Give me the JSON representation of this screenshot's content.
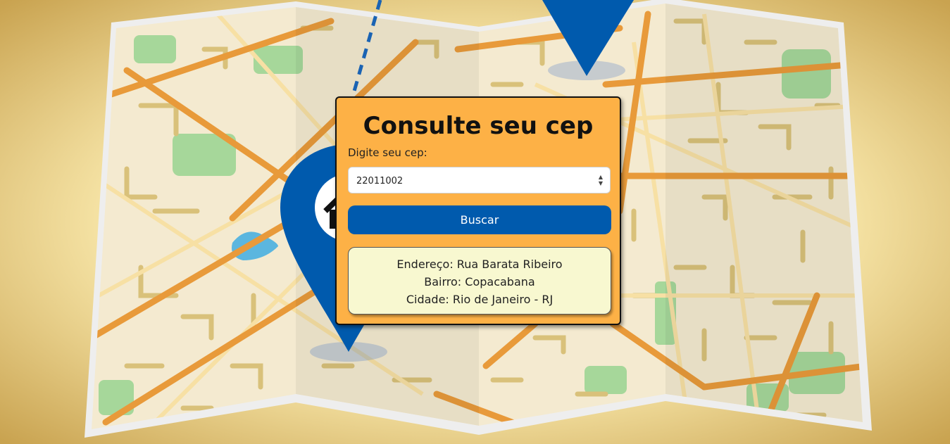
{
  "form": {
    "title": "Consulte seu cep",
    "input_label": "Digite seu cep:",
    "cep_value": "22011002",
    "search_button": "Buscar"
  },
  "result": {
    "endereco": "Endereço: Rua Barata Ribeiro",
    "bairro": "Bairro: Copacabana",
    "cidade": "Cidade: Rio de Janeiro - RJ"
  },
  "colors": {
    "page_background": "#f3dc98",
    "card": "#fdb146",
    "button": "#005aad",
    "result_box": "#f8f8d0",
    "map_pin": "#005aad"
  },
  "icons": [
    "map-illustration",
    "map-pin-icon",
    "home-icon"
  ]
}
